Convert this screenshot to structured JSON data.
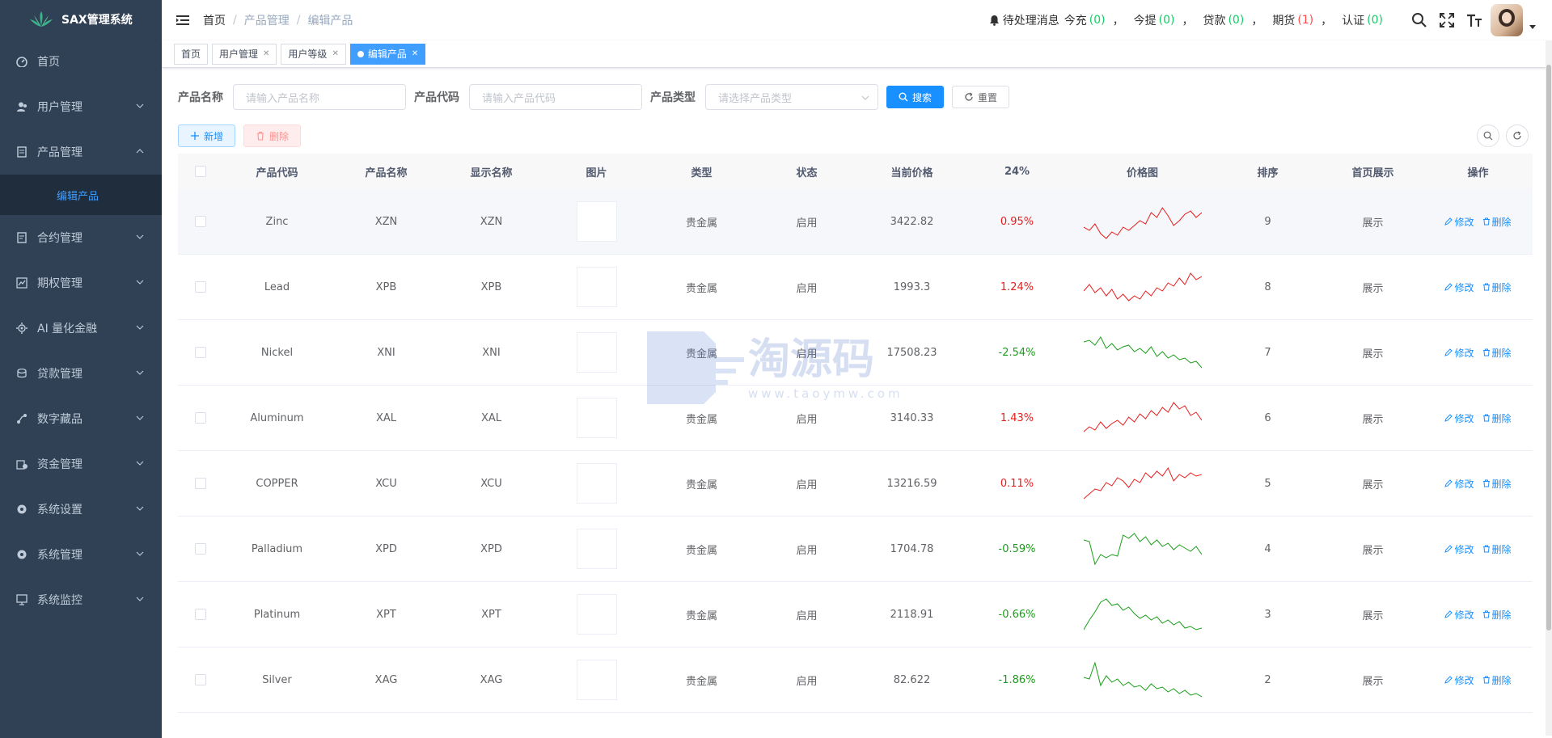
{
  "app": {
    "title": "SAX管理系统"
  },
  "sidebar": {
    "items": [
      {
        "label": "首页",
        "icon": "dashboard-icon"
      },
      {
        "label": "用户管理",
        "icon": "user-icon"
      },
      {
        "label": "产品管理",
        "icon": "document-icon",
        "open": true,
        "children": [
          {
            "label": "编辑产品"
          }
        ]
      },
      {
        "label": "合约管理",
        "icon": "contract-icon"
      },
      {
        "label": "期权管理",
        "icon": "chart-icon"
      },
      {
        "label": "AI 量化金融",
        "icon": "ai-icon"
      },
      {
        "label": "贷款管理",
        "icon": "loan-icon"
      },
      {
        "label": "数字藏品",
        "icon": "nft-icon"
      },
      {
        "label": "资金管理",
        "icon": "fund-icon"
      },
      {
        "label": "系统设置",
        "icon": "settings-icon"
      },
      {
        "label": "系统管理",
        "icon": "gear-icon"
      },
      {
        "label": "系统监控",
        "icon": "monitor-icon"
      }
    ]
  },
  "breadcrumb": {
    "home": "首页",
    "items": [
      "产品管理",
      "编辑产品"
    ],
    "sep": "/"
  },
  "header": {
    "notice_label": "待处理消息",
    "counters": [
      {
        "label": "今充",
        "value": "(0)",
        "color": "green"
      },
      {
        "label": "今提",
        "value": "(0)",
        "color": "green"
      },
      {
        "label": "贷款",
        "value": "(0)",
        "color": "green"
      },
      {
        "label": "期货",
        "value": "(1)",
        "color": "red"
      },
      {
        "label": "认证",
        "value": "(0)",
        "color": "green"
      }
    ],
    "comma": "，"
  },
  "tags": [
    {
      "label": "首页",
      "closable": false,
      "active": false
    },
    {
      "label": "用户管理",
      "closable": true,
      "active": false
    },
    {
      "label": "用户等级",
      "closable": true,
      "active": false
    },
    {
      "label": "编辑产品",
      "closable": true,
      "active": true
    }
  ],
  "search": {
    "name_label": "产品名称",
    "name_placeholder": "请输入产品名称",
    "code_label": "产品代码",
    "code_placeholder": "请输入产品代码",
    "type_label": "产品类型",
    "type_placeholder": "请选择产品类型",
    "search_btn": "搜索",
    "reset_btn": "重置"
  },
  "actions": {
    "add": "新增",
    "delete": "删除"
  },
  "table": {
    "headers": [
      "产品代码",
      "产品名称",
      "显示名称",
      "图片",
      "类型",
      "状态",
      "当前价格",
      "24%",
      "价格图",
      "排序",
      "首页展示",
      "操作"
    ],
    "edit_label": "修改",
    "delete_label": "删除",
    "rows": [
      {
        "code": "Zinc",
        "name": "XZN",
        "display": "XZN",
        "type": "贵金属",
        "status": "启用",
        "price": "3422.82",
        "change": "0.95%",
        "dir": "up",
        "sort": "9",
        "home": "展示",
        "spark": [
          30,
          34,
          26,
          38,
          44,
          36,
          40,
          30,
          34,
          28,
          22,
          26,
          12,
          18,
          6,
          16,
          28,
          22,
          14,
          10,
          18,
          12
        ]
      },
      {
        "code": "Lead",
        "name": "XPB",
        "display": "XPB",
        "type": "贵金属",
        "status": "启用",
        "price": "1993.3",
        "change": "1.24%",
        "dir": "up",
        "sort": "8",
        "home": "展示",
        "spark": [
          28,
          20,
          30,
          24,
          34,
          26,
          38,
          32,
          40,
          34,
          38,
          28,
          34,
          24,
          28,
          18,
          22,
          12,
          20,
          6,
          14,
          10
        ]
      },
      {
        "code": "Nickel",
        "name": "XNI",
        "display": "XNI",
        "type": "贵金属",
        "status": "启用",
        "price": "17508.23",
        "change": "-2.54%",
        "dir": "down",
        "sort": "7",
        "home": "展示",
        "spark": [
          10,
          8,
          14,
          4,
          18,
          12,
          20,
          16,
          14,
          22,
          18,
          24,
          16,
          28,
          22,
          30,
          26,
          32,
          30,
          36,
          34,
          42
        ]
      },
      {
        "code": "Aluminum",
        "name": "XAL",
        "display": "XAL",
        "type": "贵金属",
        "status": "启用",
        "price": "3140.33",
        "change": "1.43%",
        "dir": "up",
        "sort": "6",
        "home": "展示",
        "spark": [
          40,
          34,
          38,
          28,
          36,
          30,
          26,
          32,
          22,
          28,
          18,
          24,
          14,
          20,
          10,
          16,
          4,
          12,
          8,
          20,
          16,
          26
        ]
      },
      {
        "code": "COPPER",
        "name": "XCU",
        "display": "XCU",
        "type": "贵金属",
        "status": "启用",
        "price": "13216.59",
        "change": "0.11%",
        "dir": "up",
        "sort": "5",
        "home": "展示",
        "spark": [
          42,
          36,
          30,
          32,
          22,
          26,
          16,
          20,
          28,
          18,
          22,
          10,
          16,
          8,
          14,
          4,
          20,
          12,
          16,
          10,
          14,
          12
        ]
      },
      {
        "code": "Palladium",
        "name": "XPD",
        "display": "XPD",
        "type": "贵金属",
        "status": "启用",
        "price": "1704.78",
        "change": "-0.59%",
        "dir": "down",
        "sort": "4",
        "home": "展示",
        "spark": [
          12,
          14,
          42,
          30,
          34,
          30,
          32,
          6,
          10,
          4,
          14,
          8,
          18,
          12,
          20,
          16,
          24,
          18,
          22,
          26,
          20,
          30
        ]
      },
      {
        "code": "Platinum",
        "name": "XPT",
        "display": "XPT",
        "type": "贵金属",
        "status": "启用",
        "price": "2118.91",
        "change": "-0.66%",
        "dir": "down",
        "sort": "3",
        "home": "展示",
        "spark": [
          42,
          30,
          20,
          8,
          4,
          12,
          10,
          18,
          14,
          22,
          28,
          24,
          30,
          26,
          34,
          30,
          36,
          32,
          40,
          38,
          42,
          40
        ]
      },
      {
        "code": "Silver",
        "name": "XAG",
        "display": "XAG",
        "type": "贵金属",
        "status": "启用",
        "price": "82.622",
        "change": "-1.86%",
        "dir": "down",
        "sort": "2",
        "home": "展示",
        "spark": [
          20,
          22,
          2,
          30,
          18,
          26,
          22,
          30,
          26,
          32,
          30,
          36,
          28,
          34,
          32,
          38,
          34,
          40,
          36,
          42,
          40,
          44
        ]
      }
    ]
  },
  "watermark": {
    "cn": "淘源码",
    "en": "www.taoymw.com"
  },
  "colors": {
    "sidebar_bg": "#304156",
    "submenu_bg": "#1f2d3d",
    "primary": "#1890ff",
    "up": "#e81c1c",
    "down": "#1a9e1a"
  }
}
